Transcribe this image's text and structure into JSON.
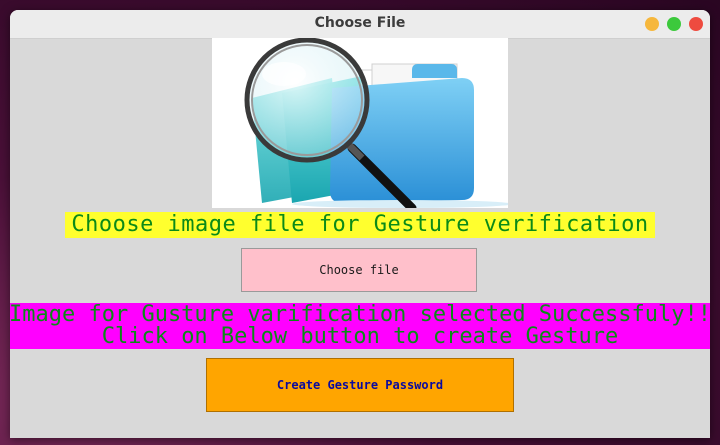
{
  "window": {
    "title": "Choose File",
    "controls": {
      "minimize_color": "#f6b73c",
      "maximize_color": "#3cc93c",
      "close_color": "#ee4b3f"
    }
  },
  "main": {
    "picture_icon": "folder-magnifier-icon",
    "heading": "Choose image file for Gesture verification",
    "choose_button_label": "Choose file",
    "status_line1": "Image for Gusture varification selected Successfuly!!",
    "status_line2": "Click on Below button to create Gesture",
    "create_button_label": "Create Gesture Password",
    "colors": {
      "heading_bg": "#ffff2e",
      "heading_text": "#0b8a18",
      "choose_button_bg": "#ffc0cb",
      "status_bg": "#ff00ff",
      "create_button_bg": "#ffa500",
      "create_button_text": "#0a0aa0"
    }
  }
}
